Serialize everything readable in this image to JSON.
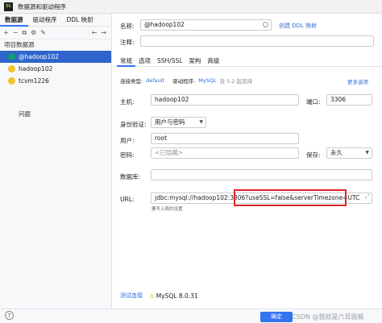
{
  "window": {
    "title": "数据源和驱动程序",
    "logo_text": "DG"
  },
  "left": {
    "tabs": [
      "数据源",
      "驱动程序",
      "DDL 映射"
    ],
    "toolbar": {
      "add": "+",
      "remove": "−",
      "copy": "⧉",
      "settings": "⚙",
      "edit": "✎",
      "back": "←",
      "forward": "→"
    },
    "section": "项目数据源",
    "items": [
      {
        "label": "@hadoop102",
        "color": "#0f9d76"
      },
      {
        "label": "hadoop102",
        "color": "#f2c12e"
      },
      {
        "label": "tcvm1226",
        "color": "#f2c12e"
      }
    ],
    "problems_label": "问题"
  },
  "form": {
    "name_label": "名称:",
    "name_value": "@hadoop102",
    "create_ddl_link": "创建 DDL 映射",
    "comment_label": "注释:",
    "tabs": [
      "常规",
      "选项",
      "SSH/SSL",
      "架构",
      "高级"
    ],
    "conn_type_label": "连接类型:",
    "conn_type_value": "default",
    "driver_label": "驱动程序:",
    "driver_value": "MySQL",
    "driver_note": "自 5.2 起支持",
    "more_options": "更多选项",
    "host_label": "主机:",
    "host_value": "hadoop102",
    "port_label": "端口:",
    "port_value": "3306",
    "auth_label": "身份验证:",
    "auth_value": "用户与密码",
    "user_label": "用户:",
    "user_value": "root",
    "password_label": "密码:",
    "password_placeholder": "<已隐藏>",
    "save_label": "保存:",
    "save_value": "永久",
    "database_label": "数据库:",
    "url_label": "URL:",
    "url_value": "jdbc:mysql://hadoop102:3306?useSSL=false&serverTimezone=UTC",
    "url_hint": "覆写上面的设置",
    "test_link": "测试连接",
    "mysql_version": "MySQL 8.0.31"
  },
  "bottom": {
    "help": "?",
    "ok_label": "确定",
    "watermark": "CSDN @我就是六耳猕猴"
  },
  "colors": {
    "accent": "#3574f0",
    "selection": "#2f65ca",
    "highlight": "#e0242a"
  }
}
